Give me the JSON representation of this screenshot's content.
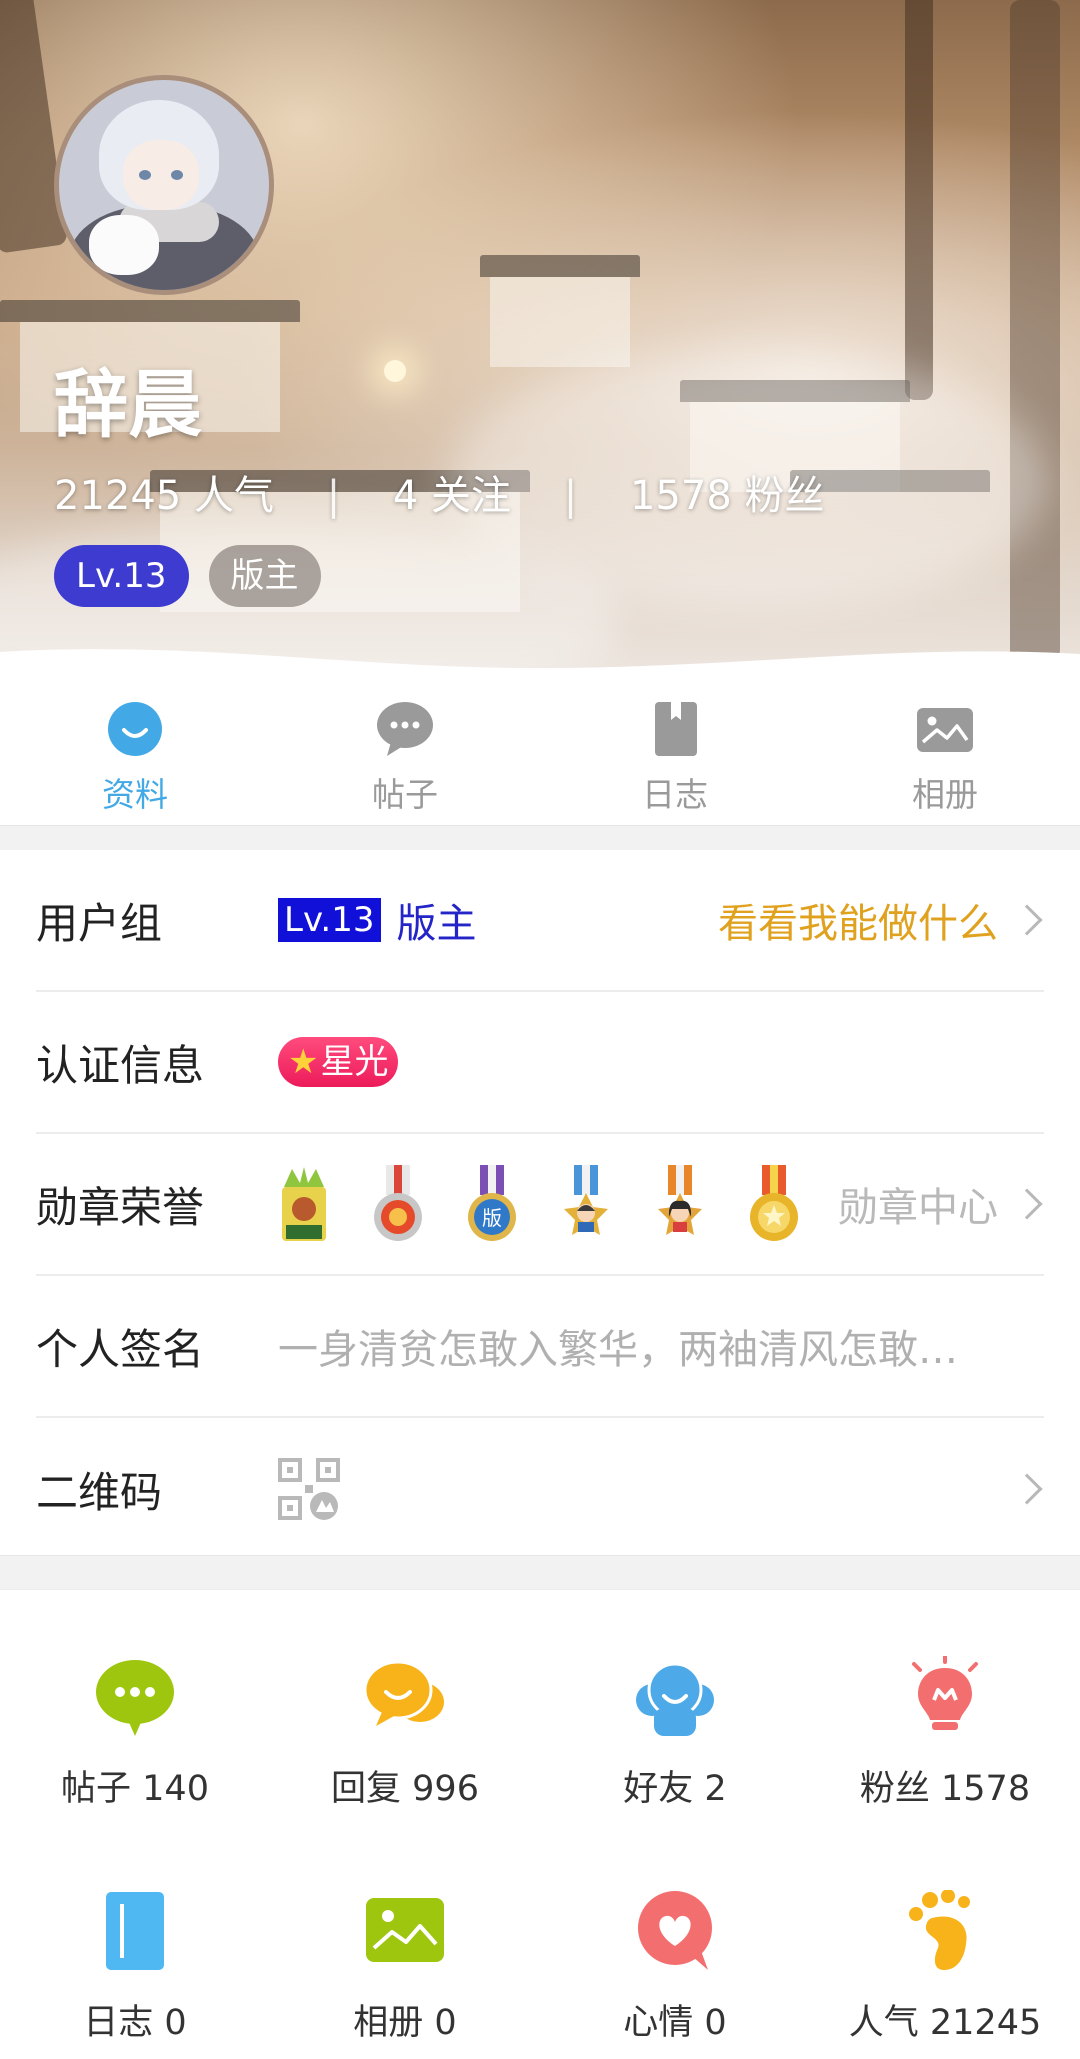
{
  "profile": {
    "name": "辞晨",
    "stats": {
      "popularity": "21245 人气",
      "following": "4 关注",
      "fans": "1578 粉丝",
      "separator": "|"
    },
    "level": "Lv.13",
    "role": "版主"
  },
  "tabs": [
    {
      "label": "资料",
      "icon": "smile-icon",
      "active": true
    },
    {
      "label": "帖子",
      "icon": "chat-bubble-icon",
      "active": false
    },
    {
      "label": "日志",
      "icon": "book-icon",
      "active": false
    },
    {
      "label": "相册",
      "icon": "image-icon",
      "active": false
    }
  ],
  "info": {
    "user_group": {
      "label": "用户组",
      "level": "Lv.13",
      "role": "版主",
      "action": "看看我能做什么"
    },
    "certification": {
      "label": "认证信息",
      "badge_star": "★",
      "badge_text": "星光"
    },
    "medals": {
      "label": "勋章荣誉",
      "link": "勋章中心",
      "medal_icons": [
        "rich-medal-icon",
        "heart-medal-icon",
        "moderator-medal-icon",
        "boy-medal-icon",
        "girl-medal-icon",
        "gold-medal-icon"
      ]
    },
    "signature": {
      "label": "个人签名",
      "text": "一身清贫怎敢入繁华，两袖清风怎敢…"
    },
    "qrcode": {
      "label": "二维码",
      "icon": "qr-code-icon"
    }
  },
  "grid": [
    {
      "label": "帖子 140",
      "icon": "posts-icon",
      "color": "#9ec60f"
    },
    {
      "label": "回复 996",
      "icon": "reply-icon",
      "color": "#f7b319"
    },
    {
      "label": "好友 2",
      "icon": "friends-icon",
      "color": "#4ea9e8"
    },
    {
      "label": "粉丝 1578",
      "icon": "fans-icon",
      "color": "#f36f6f"
    },
    {
      "label": "日志 0",
      "icon": "diary-icon",
      "color": "#4fb8f2"
    },
    {
      "label": "相册 0",
      "icon": "album-icon",
      "color": "#9ec60f"
    },
    {
      "label": "心情 0",
      "icon": "mood-icon",
      "color": "#f36f6f"
    },
    {
      "label": "人气 21245",
      "icon": "popularity-icon",
      "color": "#f7b319"
    }
  ],
  "colors": {
    "accent": "#43a9e6",
    "level_badge": "#3d3bd0",
    "action_orange": "#e0a21e",
    "star_badge": "#ec1b5a"
  }
}
